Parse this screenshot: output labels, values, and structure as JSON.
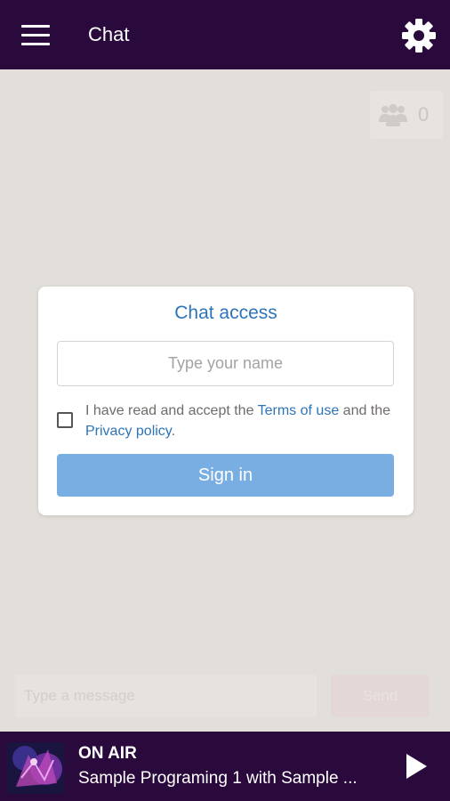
{
  "header": {
    "title": "Chat",
    "menu_icon": "hamburger-menu-icon",
    "settings_icon": "gear-icon",
    "background": "#2a0a3c"
  },
  "users": {
    "icon": "users-icon",
    "count": "0"
  },
  "chat_access": {
    "title": "Chat access",
    "name_placeholder": "Type your name",
    "name_value": "",
    "checkbox_checked": false,
    "terms_prefix": "I have read and accept the ",
    "terms_link": "Terms of use",
    "terms_middle": " and the ",
    "privacy_link": "Privacy policy",
    "terms_suffix": ".",
    "signin_label": "Sign in",
    "accent": "#2d74b8",
    "button_color": "#79aee2"
  },
  "composer": {
    "message_placeholder": "Type a message",
    "send_label": "Send"
  },
  "player": {
    "status": "ON AIR",
    "program": "Sample Programing 1 with Sample ...",
    "play_icon": "play-icon",
    "cover_icon": "album-cover-image"
  }
}
